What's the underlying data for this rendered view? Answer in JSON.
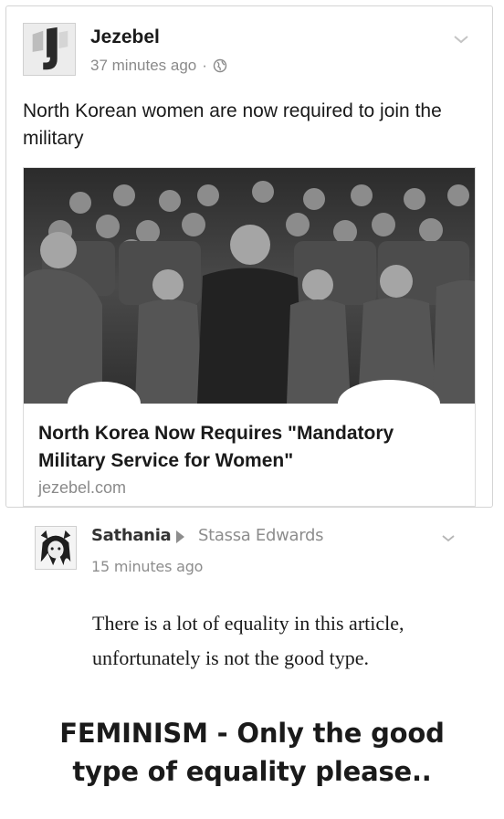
{
  "post": {
    "page_name": "Jezebel",
    "timestamp": "37 minutes ago",
    "separator": "·",
    "privacy_icon": "globe-icon",
    "text": "North Korean women are now required to join the military",
    "menu_icon": "chevron-down-icon",
    "link": {
      "title": "North Korea Now Requires \"Mandatory Military Service for Women\"",
      "domain": "jezebel.com"
    }
  },
  "comment": {
    "author": "Sathania",
    "arrow_icon": "triangle-right-icon",
    "target": "Stassa Edwards",
    "timestamp": "15 minutes ago",
    "menu_icon": "chevron-down-icon",
    "body": "There is a lot of equality in this article, unfortunately is not the good type."
  },
  "caption": {
    "line1": "FEMINISM - Only the good",
    "line2": "type of equality please.."
  },
  "colors": {
    "text": "#1a1a1a",
    "muted": "#8a8a8a",
    "border": "#d4d4d4"
  }
}
